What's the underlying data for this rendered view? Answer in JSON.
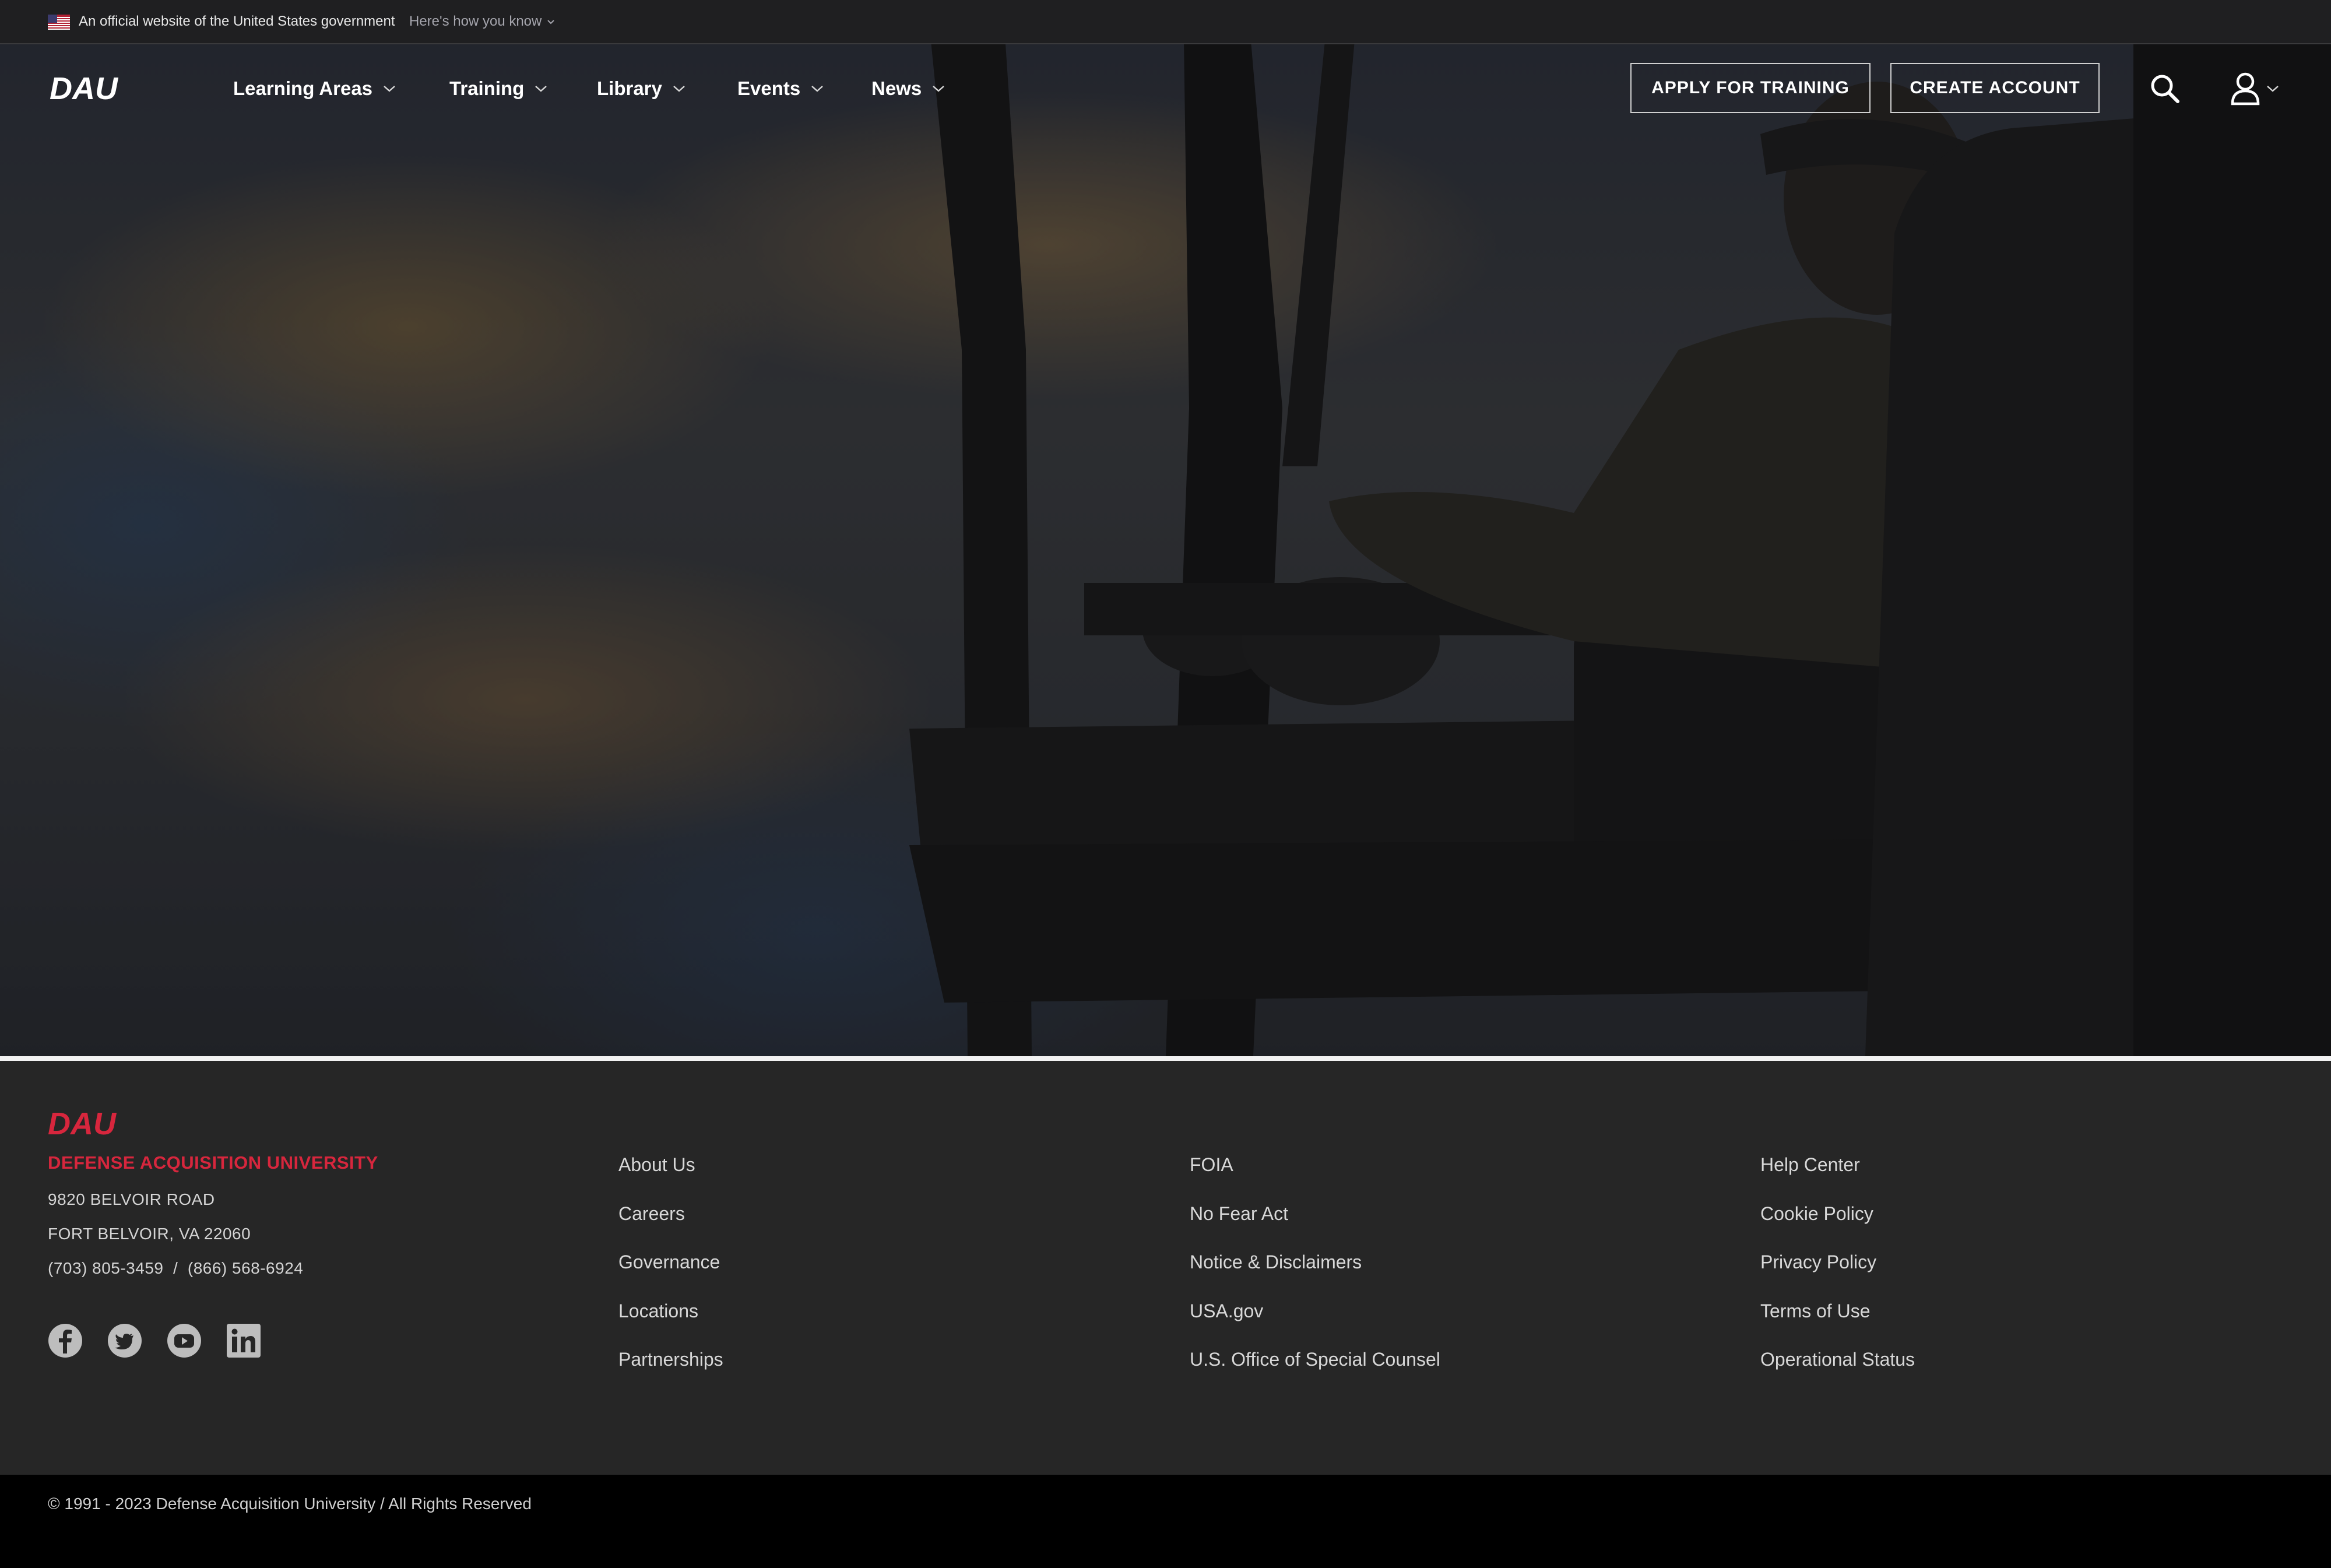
{
  "gov_banner": {
    "text": "An official website of the United States government",
    "how_link": "Here's how you know"
  },
  "brand": {
    "logo_text": "DAU",
    "accent_color": "#d7263d"
  },
  "nav": {
    "items": [
      {
        "label": "Learning Areas"
      },
      {
        "label": "Training"
      },
      {
        "label": "Library"
      },
      {
        "label": "Events"
      },
      {
        "label": "News"
      }
    ],
    "apply_label": "APPLY FOR TRAINING",
    "create_label": "CREATE ACCOUNT",
    "search_icon": "search-icon",
    "user_icon": "user-icon"
  },
  "footer": {
    "university": "DEFENSE ACQUISITION UNIVERSITY",
    "address_line1": "9820 BELVOIR ROAD",
    "address_line2": "FORT BELVOIR, VA 22060",
    "phone": "(703) 805-3459  /  (866) 568-6924",
    "socials": [
      "facebook-icon",
      "twitter-icon",
      "youtube-icon",
      "linkedin-icon"
    ],
    "col1": [
      "About Us",
      "Careers",
      "Governance",
      "Locations",
      "Partnerships"
    ],
    "col2": [
      "FOIA",
      "No Fear Act",
      "Notice & Disclaimers",
      "USA.gov",
      "U.S. Office of Special Counsel"
    ],
    "col3": [
      "Help Center",
      "Cookie Policy",
      "Privacy Policy",
      "Terms of Use",
      "Operational Status"
    ],
    "copyright": "© 1991 - 2023 Defense Acquisition University / All Rights Reserved"
  }
}
